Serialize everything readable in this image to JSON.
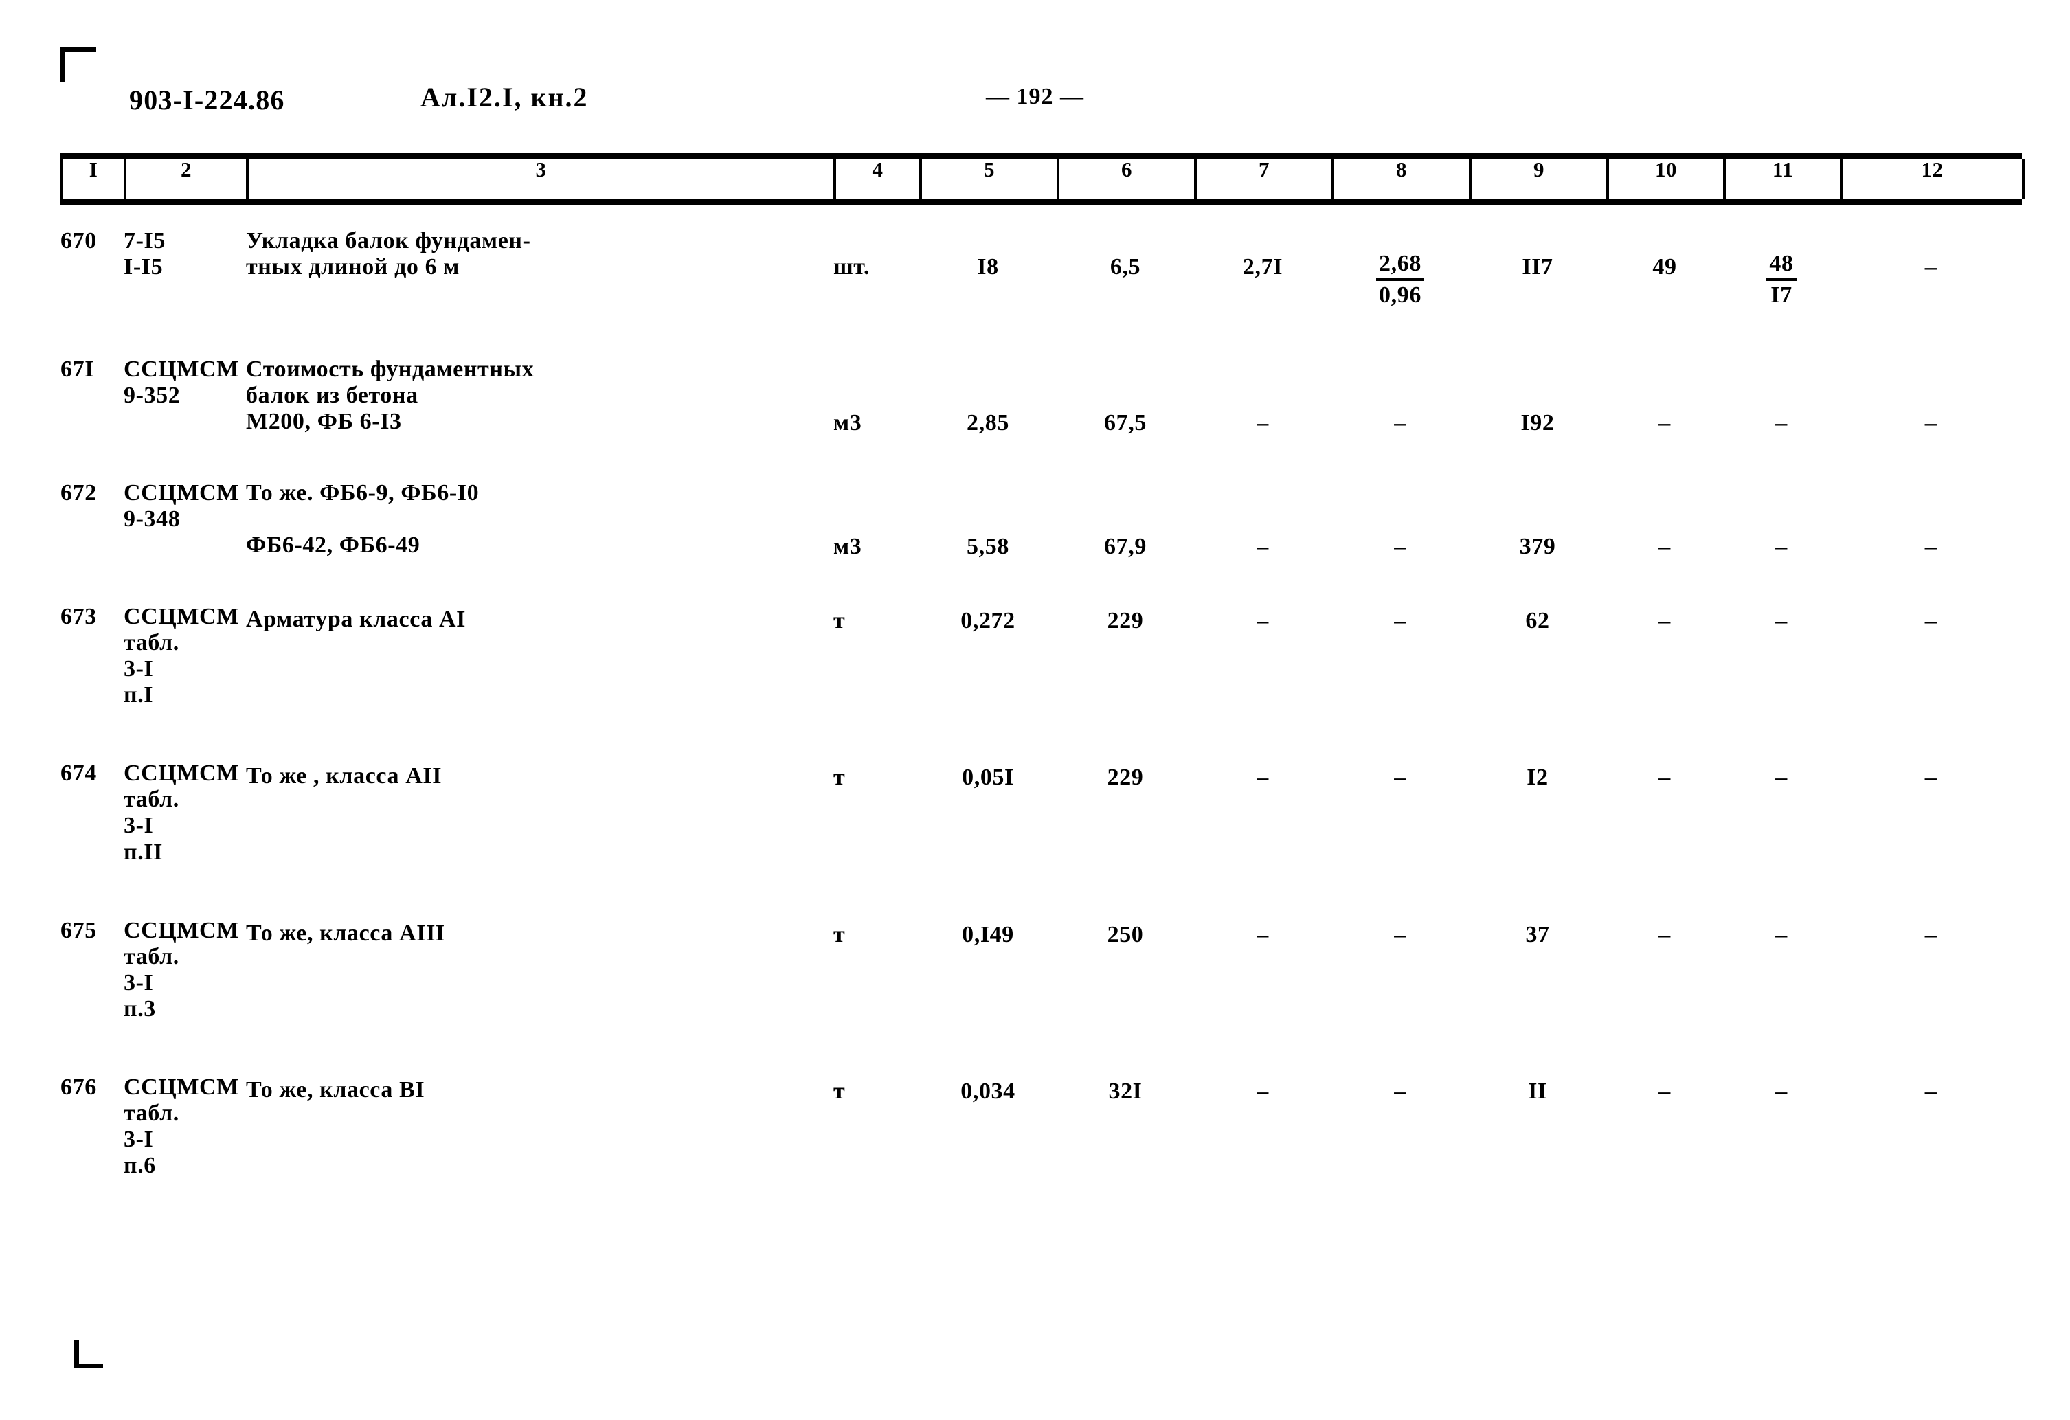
{
  "header": {
    "doc_code": "903-I-224.86",
    "album": "Ал.I2.I, кн.2",
    "page_number": "— 192 —"
  },
  "table": {
    "column_numbers": [
      "I",
      "2",
      "3",
      "4",
      "5",
      "6",
      "7",
      "8",
      "9",
      "10",
      "11",
      "12"
    ],
    "rows": [
      {
        "num": "670",
        "code": "7-I5\nI-I5",
        "description": "Укладка балок фундамен-\nтных длиной до 6 м",
        "unit": "шт.",
        "c5": "I8",
        "c6": "6,5",
        "c7": "2,7I",
        "c8_top": "2,68",
        "c8_bottom": "0,96",
        "c9": "II7",
        "c10": "49",
        "c11_top": "48",
        "c11_bottom": "I7",
        "c12": "–"
      },
      {
        "num": "67I",
        "code": "ССЦМСМ\n9-352",
        "description": "Стоимость фундаментных\nбалок из бетона\nМ200, ФБ 6-I3",
        "unit": "м3",
        "c5": "2,85",
        "c6": "67,5",
        "c7": "–",
        "c8": "–",
        "c9": "I92",
        "c10": "–",
        "c11": "–",
        "c12": "–"
      },
      {
        "num": "672",
        "code": "ССЦМСМ\n9-348",
        "description": "То же. ФБ6-9, ФБ6-I0\n\nФБ6-42, ФБ6-49",
        "unit": "м3",
        "c5": "5,58",
        "c6": "67,9",
        "c7": "–",
        "c8": "–",
        "c9": "379",
        "c10": "–",
        "c11": "–",
        "c12": "–"
      },
      {
        "num": "673",
        "code": "ССЦМСМ\nтабл.\n3-I\nп.I",
        "description": "Арматура класса АI",
        "unit": "т",
        "c5": "0,272",
        "c6": "229",
        "c7": "–",
        "c8": "–",
        "c9": "62",
        "c10": "–",
        "c11": "–",
        "c12": "–"
      },
      {
        "num": "674",
        "code": "ССЦМСМ\nтабл.\n3-I\nп.II",
        "description": "То же , класса АII",
        "unit": "т",
        "c5": "0,05I",
        "c6": "229",
        "c7": "–",
        "c8": "–",
        "c9": "I2",
        "c10": "–",
        "c11": "–",
        "c12": "–"
      },
      {
        "num": "675",
        "code": "ССЦМСМ\nтабл.\n3-I\nп.3",
        "description": "То же, класса АIII",
        "unit": "т",
        "c5": "0,I49",
        "c6": "250",
        "c7": "–",
        "c8": "–",
        "c9": "37",
        "c10": "–",
        "c11": "–",
        "c12": "–"
      },
      {
        "num": "676",
        "code": "ССЦМСМ\nтабл.\n3-I\nп.6",
        "description": "То же, класса ВI",
        "unit": "т",
        "c5": "0,034",
        "c6": "32I",
        "c7": "–",
        "c8": "–",
        "c9": "II",
        "c10": "–",
        "c11": "–",
        "c12": "–"
      }
    ]
  }
}
